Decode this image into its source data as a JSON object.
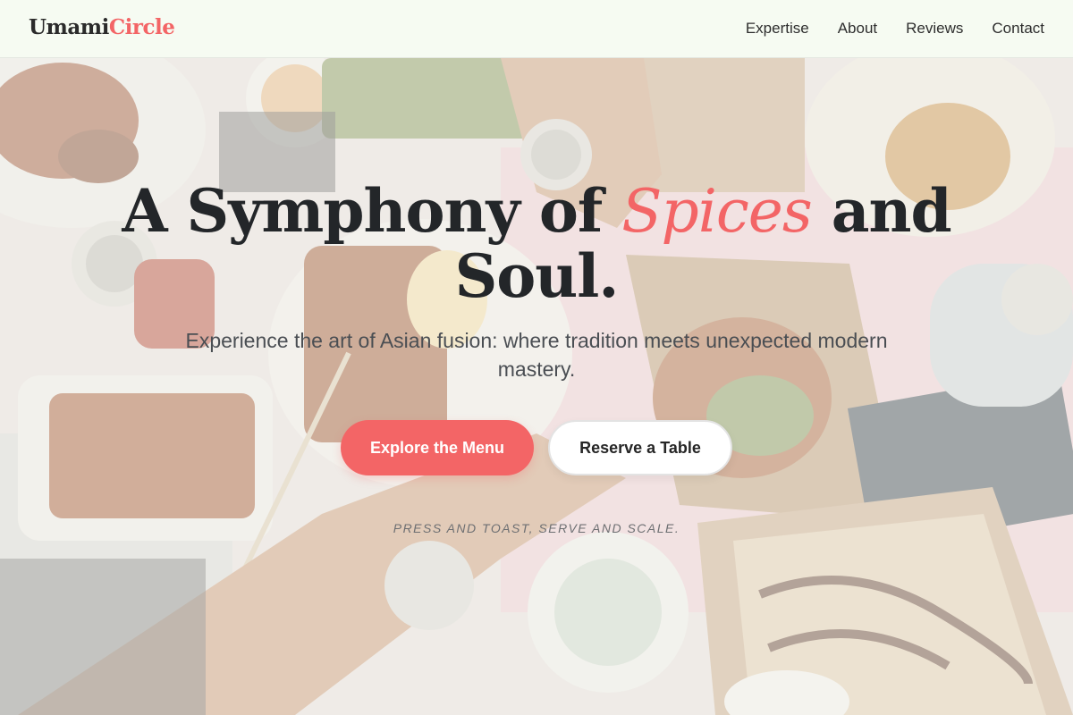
{
  "header": {
    "logo_part1": "Umami",
    "logo_part2": "Circle",
    "nav": [
      "Expertise",
      "About",
      "Reviews",
      "Contact"
    ]
  },
  "hero": {
    "headline_part1": "A Symphony of ",
    "headline_accent": "Spices",
    "headline_part2": " and Soul.",
    "subtitle": "Experience the art of Asian fusion: where tradition meets unexpected modern mastery.",
    "primary_button": "Explore the Menu",
    "secondary_button": "Reserve a Table",
    "tagline": "PRESS AND TOAST, SERVE AND SCALE."
  },
  "colors": {
    "accent": "#f36566",
    "header_bg": "#f6fbf2",
    "text_dark": "#232629"
  },
  "background_image": "overhead-food-table-photo"
}
